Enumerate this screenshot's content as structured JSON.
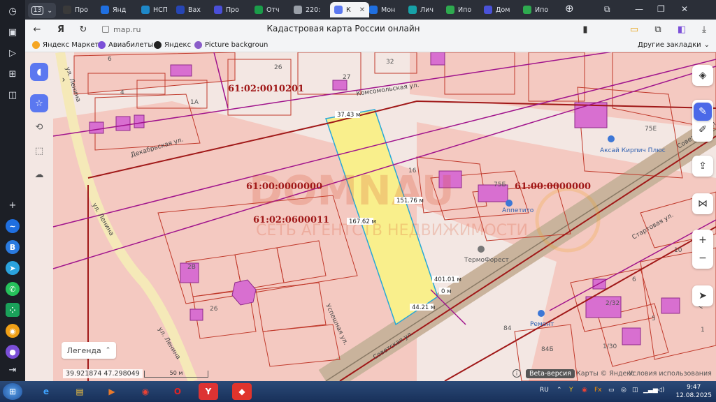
{
  "tabs": [
    {
      "label": "Про",
      "color": "#3a3a3a"
    },
    {
      "label": "Янд",
      "color": "#1f6fe0"
    },
    {
      "label": "НСП",
      "color": "#1e88c8"
    },
    {
      "label": "Вах",
      "color": "#2746b5"
    },
    {
      "label": "Про",
      "color": "#4a4fd8"
    },
    {
      "label": "Отч",
      "color": "#1b9d4a"
    },
    {
      "label": "220:",
      "color": "#9aa0a8"
    },
    {
      "label": "К",
      "color": "#5b78f0",
      "active": true
    },
    {
      "label": "Мон",
      "color": "#1f6fe0"
    },
    {
      "label": "Лич",
      "color": "#17a2a8"
    },
    {
      "label": "Ипо",
      "color": "#2eaa4f"
    },
    {
      "label": "Дом",
      "color": "#4a52d8"
    },
    {
      "label": "Ипо",
      "color": "#2eaa4f"
    }
  ],
  "tab_counter": "13",
  "address": {
    "url": "map.ru",
    "title": "Кадастровая карта России онлайн"
  },
  "bookmarks": [
    {
      "label": "Яндекс Маркет",
      "color": "#f5a623"
    },
    {
      "label": "Авиабилеты",
      "color": "#7b4fd8"
    },
    {
      "label": "Яндекс",
      "color": "#222222"
    },
    {
      "label": "Picture backgroun",
      "color": "#8a5cc9"
    }
  ],
  "bookmarks_more": "Другие закладки",
  "map": {
    "parcel_labels": [
      "61:02:0010201",
      "61:00:0000000",
      "61:02:0600011",
      "61:00:0000000"
    ],
    "measurements": [
      "37.43 м",
      "151.76 м",
      "167.62 м",
      "401.01 м",
      "0 м",
      "44.21 м"
    ],
    "streets": [
      "Комсомольская ул.",
      "Декабрьская ул.",
      "ул. Ленина",
      "ул. Ленина",
      "ул. Ленина",
      "Успешная ул.",
      "Советская ул.",
      "Стартовая ул.",
      "Советская ул.",
      "Мус"
    ],
    "house_numbers": [
      "6",
      "26",
      "27",
      "32",
      "4",
      "1А",
      "16",
      "75Б",
      "75Е",
      "26",
      "2В",
      "84",
      "84Б",
      "1/30",
      "2/32",
      "6",
      "5",
      "10",
      "1"
    ],
    "poi": [
      {
        "name": "Аксай Кирпич Плюс"
      },
      {
        "name": "Аппетито"
      },
      {
        "name": "ТермоФорест"
      },
      {
        "name": "Ремонт"
      }
    ],
    "watermark": {
      "brand": "DOMNAU",
      "subtitle": "СЕТЬ АГЕНТСТВ НЕДВИЖИМОСТИ"
    }
  },
  "legend": "Легенда",
  "coordinates": "39.921874  47.298049",
  "scale": "50 м",
  "beta": "Beta-версия",
  "copyright": "Карты © Яндекс",
  "terms": "Условия использования",
  "taskbar": {
    "lang": "RU",
    "time": "9:47",
    "date": "12.08.2025"
  }
}
